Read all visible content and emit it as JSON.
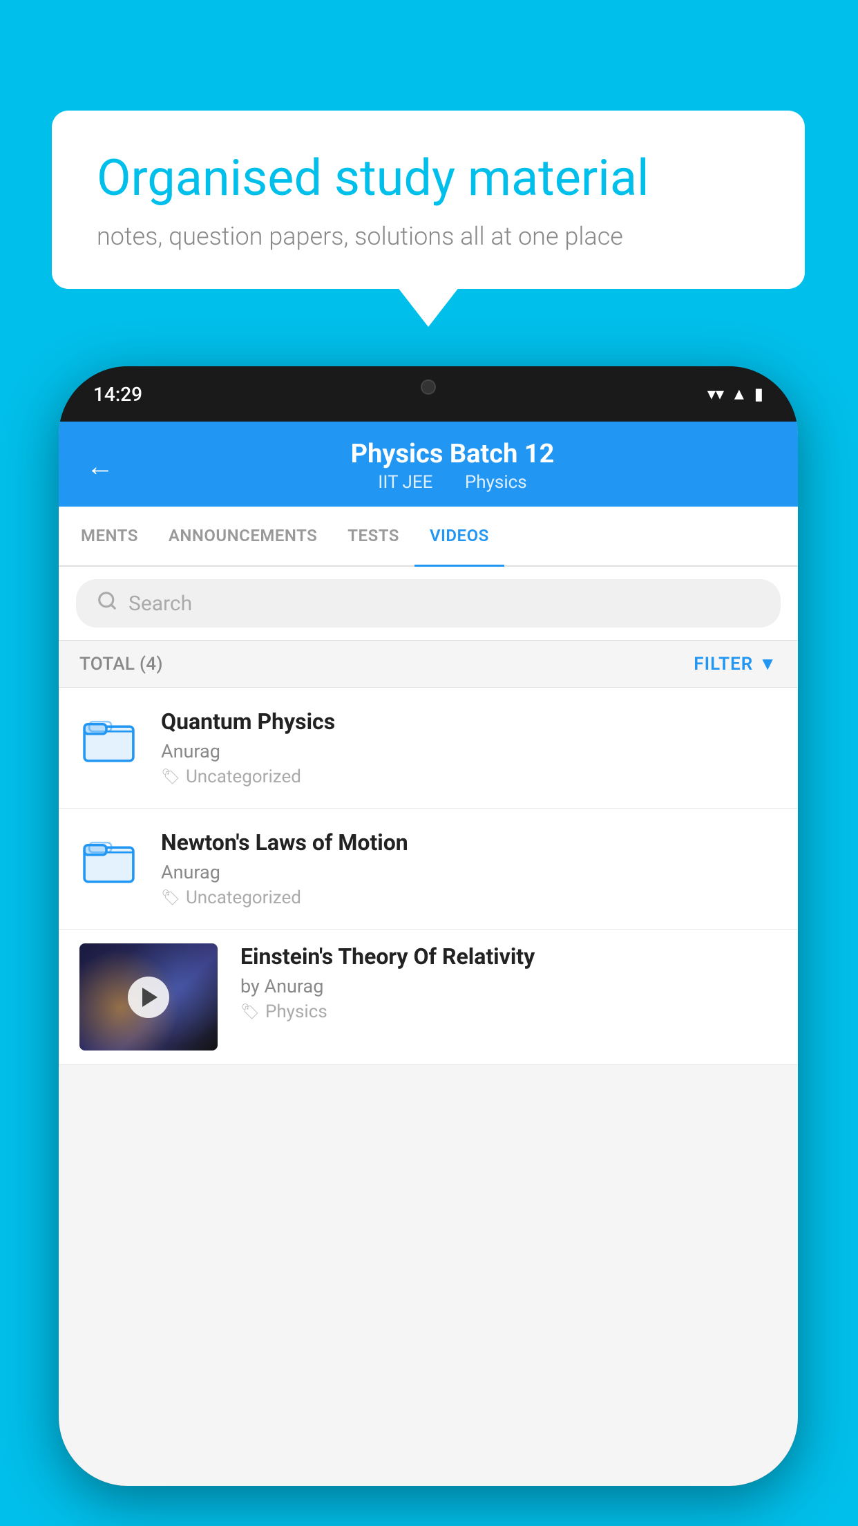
{
  "background": {
    "color": "#00BFEA"
  },
  "speech_bubble": {
    "title": "Organised study material",
    "subtitle": "notes, question papers, solutions all at one place"
  },
  "phone": {
    "status_bar": {
      "time": "14:29"
    },
    "header": {
      "back_label": "←",
      "title": "Physics Batch 12",
      "subtitle1": "IIT JEE",
      "subtitle2": "Physics"
    },
    "tabs": [
      {
        "label": "MENTS",
        "active": false
      },
      {
        "label": "ANNOUNCEMENTS",
        "active": false
      },
      {
        "label": "TESTS",
        "active": false
      },
      {
        "label": "VIDEOS",
        "active": true
      }
    ],
    "search": {
      "placeholder": "Search"
    },
    "filter_bar": {
      "total_label": "TOTAL (4)",
      "filter_label": "FILTER"
    },
    "videos": [
      {
        "title": "Quantum Physics",
        "author": "Anurag",
        "tag": "Uncategorized",
        "has_thumbnail": false
      },
      {
        "title": "Newton's Laws of Motion",
        "author": "Anurag",
        "tag": "Uncategorized",
        "has_thumbnail": false
      },
      {
        "title": "Einstein's Theory Of Relativity",
        "author": "by Anurag",
        "tag": "Physics",
        "has_thumbnail": true
      }
    ]
  }
}
